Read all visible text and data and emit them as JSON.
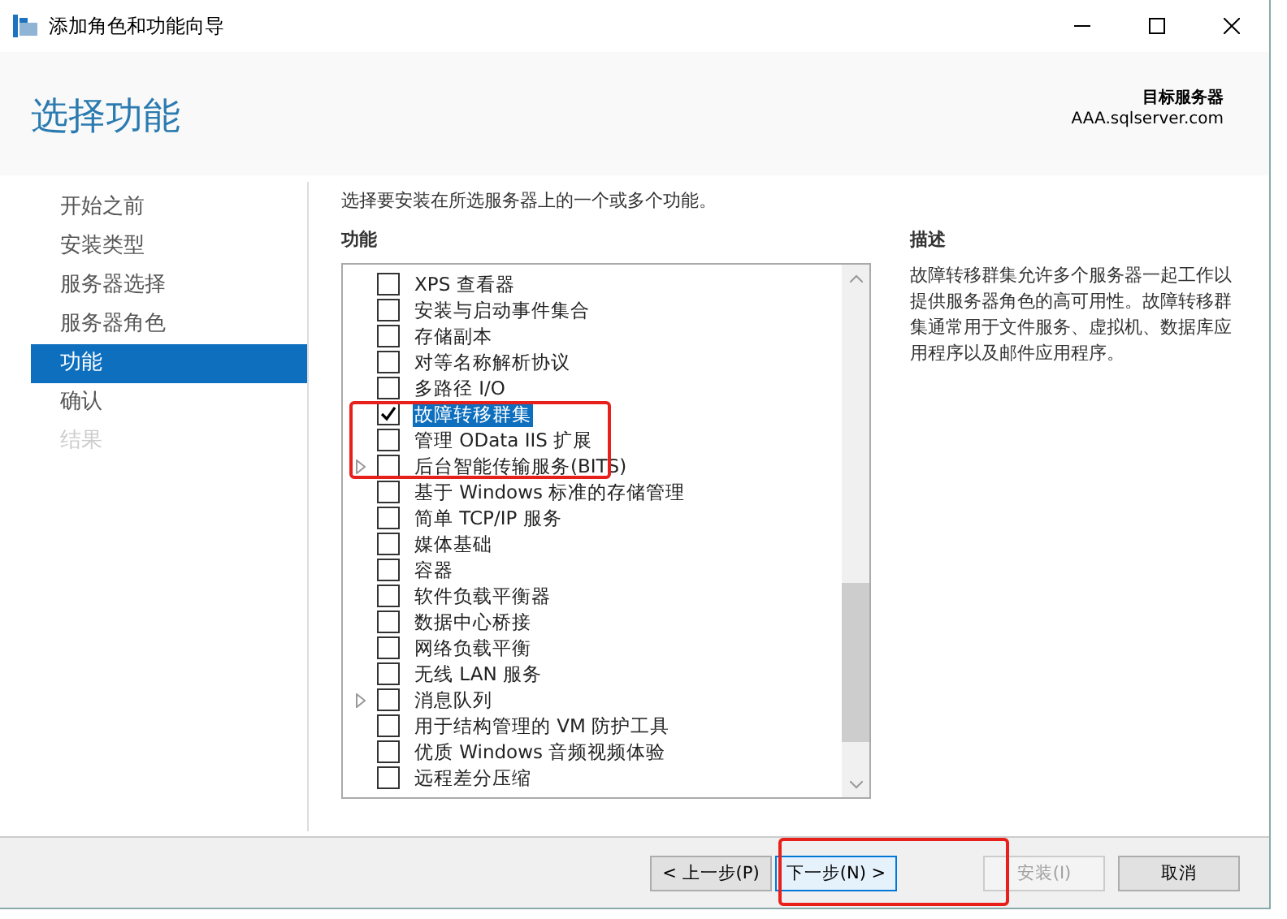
{
  "window": {
    "title": "添加角色和功能向导"
  },
  "header": {
    "title": "选择功能",
    "target_label": "目标服务器",
    "target_server": "AAA.sqlserver.com"
  },
  "sidebar": {
    "items": [
      {
        "label": "开始之前",
        "selected": false,
        "disabled": false
      },
      {
        "label": "安装类型",
        "selected": false,
        "disabled": false
      },
      {
        "label": "服务器选择",
        "selected": false,
        "disabled": false
      },
      {
        "label": "服务器角色",
        "selected": false,
        "disabled": false
      },
      {
        "label": "功能",
        "selected": true,
        "disabled": false
      },
      {
        "label": "确认",
        "selected": false,
        "disabled": false
      },
      {
        "label": "结果",
        "selected": false,
        "disabled": true
      }
    ]
  },
  "instruction": "选择要安装在所选服务器上的一个或多个功能。",
  "features": {
    "heading": "功能",
    "items": [
      {
        "label": "XPS 查看器",
        "checked": false,
        "selected": false,
        "expandable": false
      },
      {
        "label": "安装与启动事件集合",
        "checked": false,
        "selected": false,
        "expandable": false
      },
      {
        "label": "存储副本",
        "checked": false,
        "selected": false,
        "expandable": false
      },
      {
        "label": "对等名称解析协议",
        "checked": false,
        "selected": false,
        "expandable": false
      },
      {
        "label": "多路径 I/O",
        "checked": false,
        "selected": false,
        "expandable": false
      },
      {
        "label": "故障转移群集",
        "checked": true,
        "selected": true,
        "expandable": false
      },
      {
        "label": "管理 OData IIS 扩展",
        "checked": false,
        "selected": false,
        "expandable": false
      },
      {
        "label": "后台智能传输服务(BITS)",
        "checked": false,
        "selected": false,
        "expandable": true
      },
      {
        "label": "基于 Windows 标准的存储管理",
        "checked": false,
        "selected": false,
        "expandable": false
      },
      {
        "label": "简单 TCP/IP 服务",
        "checked": false,
        "selected": false,
        "expandable": false
      },
      {
        "label": "媒体基础",
        "checked": false,
        "selected": false,
        "expandable": false
      },
      {
        "label": "容器",
        "checked": false,
        "selected": false,
        "expandable": false
      },
      {
        "label": "软件负载平衡器",
        "checked": false,
        "selected": false,
        "expandable": false
      },
      {
        "label": "数据中心桥接",
        "checked": false,
        "selected": false,
        "expandable": false
      },
      {
        "label": "网络负载平衡",
        "checked": false,
        "selected": false,
        "expandable": false
      },
      {
        "label": "无线 LAN 服务",
        "checked": false,
        "selected": false,
        "expandable": false
      },
      {
        "label": "消息队列",
        "checked": false,
        "selected": false,
        "expandable": true
      },
      {
        "label": "用于结构管理的 VM 防护工具",
        "checked": false,
        "selected": false,
        "expandable": false
      },
      {
        "label": "优质 Windows 音频视频体验",
        "checked": false,
        "selected": false,
        "expandable": false
      },
      {
        "label": "远程差分压缩",
        "checked": false,
        "selected": false,
        "expandable": false
      }
    ]
  },
  "description": {
    "heading": "描述",
    "text": "故障转移群集允许多个服务器一起工作以提供服务器角色的高可用性。故障转移群集通常用于文件服务、虚拟机、数据库应用程序以及邮件应用程序。"
  },
  "buttons": [
    {
      "label": "< 上一步(P)",
      "disabled": false,
      "focused": false
    },
    {
      "label": "下一步(N) >",
      "disabled": false,
      "focused": true
    },
    {
      "label": "安装(I)",
      "disabled": true,
      "focused": false
    },
    {
      "label": "取消",
      "disabled": false,
      "focused": false
    }
  ]
}
